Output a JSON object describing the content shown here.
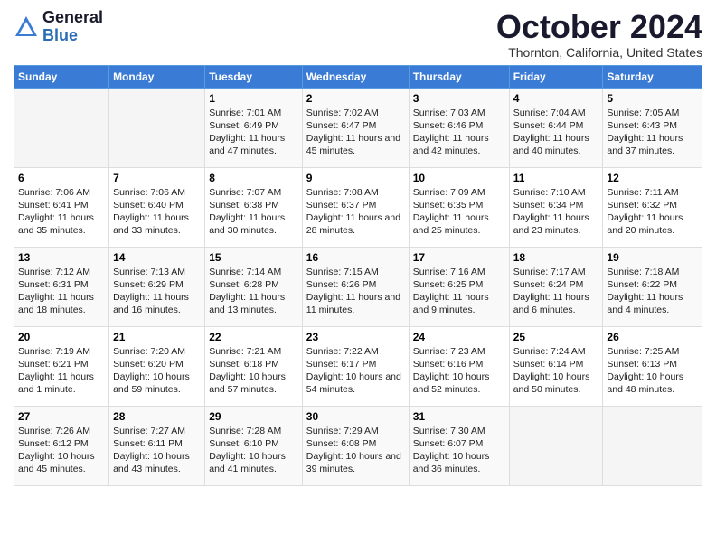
{
  "logo": {
    "general": "General",
    "blue": "Blue"
  },
  "title": "October 2024",
  "location": "Thornton, California, United States",
  "days_header": [
    "Sunday",
    "Monday",
    "Tuesday",
    "Wednesday",
    "Thursday",
    "Friday",
    "Saturday"
  ],
  "weeks": [
    [
      {
        "day": "",
        "info": ""
      },
      {
        "day": "",
        "info": ""
      },
      {
        "day": "1",
        "info": "Sunrise: 7:01 AM\nSunset: 6:49 PM\nDaylight: 11 hours and 47 minutes."
      },
      {
        "day": "2",
        "info": "Sunrise: 7:02 AM\nSunset: 6:47 PM\nDaylight: 11 hours and 45 minutes."
      },
      {
        "day": "3",
        "info": "Sunrise: 7:03 AM\nSunset: 6:46 PM\nDaylight: 11 hours and 42 minutes."
      },
      {
        "day": "4",
        "info": "Sunrise: 7:04 AM\nSunset: 6:44 PM\nDaylight: 11 hours and 40 minutes."
      },
      {
        "day": "5",
        "info": "Sunrise: 7:05 AM\nSunset: 6:43 PM\nDaylight: 11 hours and 37 minutes."
      }
    ],
    [
      {
        "day": "6",
        "info": "Sunrise: 7:06 AM\nSunset: 6:41 PM\nDaylight: 11 hours and 35 minutes."
      },
      {
        "day": "7",
        "info": "Sunrise: 7:06 AM\nSunset: 6:40 PM\nDaylight: 11 hours and 33 minutes."
      },
      {
        "day": "8",
        "info": "Sunrise: 7:07 AM\nSunset: 6:38 PM\nDaylight: 11 hours and 30 minutes."
      },
      {
        "day": "9",
        "info": "Sunrise: 7:08 AM\nSunset: 6:37 PM\nDaylight: 11 hours and 28 minutes."
      },
      {
        "day": "10",
        "info": "Sunrise: 7:09 AM\nSunset: 6:35 PM\nDaylight: 11 hours and 25 minutes."
      },
      {
        "day": "11",
        "info": "Sunrise: 7:10 AM\nSunset: 6:34 PM\nDaylight: 11 hours and 23 minutes."
      },
      {
        "day": "12",
        "info": "Sunrise: 7:11 AM\nSunset: 6:32 PM\nDaylight: 11 hours and 20 minutes."
      }
    ],
    [
      {
        "day": "13",
        "info": "Sunrise: 7:12 AM\nSunset: 6:31 PM\nDaylight: 11 hours and 18 minutes."
      },
      {
        "day": "14",
        "info": "Sunrise: 7:13 AM\nSunset: 6:29 PM\nDaylight: 11 hours and 16 minutes."
      },
      {
        "day": "15",
        "info": "Sunrise: 7:14 AM\nSunset: 6:28 PM\nDaylight: 11 hours and 13 minutes."
      },
      {
        "day": "16",
        "info": "Sunrise: 7:15 AM\nSunset: 6:26 PM\nDaylight: 11 hours and 11 minutes."
      },
      {
        "day": "17",
        "info": "Sunrise: 7:16 AM\nSunset: 6:25 PM\nDaylight: 11 hours and 9 minutes."
      },
      {
        "day": "18",
        "info": "Sunrise: 7:17 AM\nSunset: 6:24 PM\nDaylight: 11 hours and 6 minutes."
      },
      {
        "day": "19",
        "info": "Sunrise: 7:18 AM\nSunset: 6:22 PM\nDaylight: 11 hours and 4 minutes."
      }
    ],
    [
      {
        "day": "20",
        "info": "Sunrise: 7:19 AM\nSunset: 6:21 PM\nDaylight: 11 hours and 1 minute."
      },
      {
        "day": "21",
        "info": "Sunrise: 7:20 AM\nSunset: 6:20 PM\nDaylight: 10 hours and 59 minutes."
      },
      {
        "day": "22",
        "info": "Sunrise: 7:21 AM\nSunset: 6:18 PM\nDaylight: 10 hours and 57 minutes."
      },
      {
        "day": "23",
        "info": "Sunrise: 7:22 AM\nSunset: 6:17 PM\nDaylight: 10 hours and 54 minutes."
      },
      {
        "day": "24",
        "info": "Sunrise: 7:23 AM\nSunset: 6:16 PM\nDaylight: 10 hours and 52 minutes."
      },
      {
        "day": "25",
        "info": "Sunrise: 7:24 AM\nSunset: 6:14 PM\nDaylight: 10 hours and 50 minutes."
      },
      {
        "day": "26",
        "info": "Sunrise: 7:25 AM\nSunset: 6:13 PM\nDaylight: 10 hours and 48 minutes."
      }
    ],
    [
      {
        "day": "27",
        "info": "Sunrise: 7:26 AM\nSunset: 6:12 PM\nDaylight: 10 hours and 45 minutes."
      },
      {
        "day": "28",
        "info": "Sunrise: 7:27 AM\nSunset: 6:11 PM\nDaylight: 10 hours and 43 minutes."
      },
      {
        "day": "29",
        "info": "Sunrise: 7:28 AM\nSunset: 6:10 PM\nDaylight: 10 hours and 41 minutes."
      },
      {
        "day": "30",
        "info": "Sunrise: 7:29 AM\nSunset: 6:08 PM\nDaylight: 10 hours and 39 minutes."
      },
      {
        "day": "31",
        "info": "Sunrise: 7:30 AM\nSunset: 6:07 PM\nDaylight: 10 hours and 36 minutes."
      },
      {
        "day": "",
        "info": ""
      },
      {
        "day": "",
        "info": ""
      }
    ]
  ]
}
